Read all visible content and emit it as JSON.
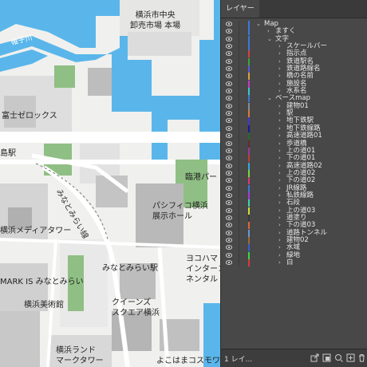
{
  "map": {
    "labels": [
      {
        "id": "market",
        "text": "横浜市中央\n卸売市場 本場"
      },
      {
        "id": "river",
        "text": "帷子川"
      },
      {
        "id": "fujixerox",
        "text": "富士ゼロックス"
      },
      {
        "id": "station_left",
        "text": "島駅"
      },
      {
        "id": "minatomirai_line",
        "text": "みなとみらい線"
      },
      {
        "id": "pier",
        "text": "臨港パー"
      },
      {
        "id": "pacifico",
        "text": "パシフィコ横浜\n展示ホール"
      },
      {
        "id": "media_tower",
        "text": "横浜メディアタワー"
      },
      {
        "id": "minatomirai_st",
        "text": "みなとみらい駅"
      },
      {
        "id": "yokohama_ic",
        "text": "ヨコハマ\nインターコ\nネンタル"
      },
      {
        "id": "markis",
        "text": "MARK IS みなとみらい"
      },
      {
        "id": "museum",
        "text": "横浜美術館"
      },
      {
        "id": "queens",
        "text": "クイーンズ\nスクエア横浜"
      },
      {
        "id": "landmark",
        "text": "横浜ランド\nマークタワー"
      },
      {
        "id": "cosmo",
        "text": "よこはまコスモワ"
      }
    ]
  },
  "panel": {
    "tab_label": "レイヤー",
    "footer_count": "1 レイ...",
    "layers": [
      {
        "name": "Map",
        "depth": 0,
        "expanded": true,
        "color": "#3a7bd5"
      },
      {
        "name": "ますく",
        "depth": 1,
        "expanded": false,
        "color": "#3a7bd5"
      },
      {
        "name": "文字",
        "depth": 1,
        "expanded": true,
        "color": "#3a7bd5"
      },
      {
        "name": "スケールバー",
        "depth": 2,
        "expanded": false,
        "color": "#3a7bd5"
      },
      {
        "name": "指示点",
        "depth": 2,
        "expanded": false,
        "color": "#d94040"
      },
      {
        "name": "鉄道駅名",
        "depth": 2,
        "expanded": false,
        "color": "#3aa83a"
      },
      {
        "name": "鉄道路線名",
        "depth": 2,
        "expanded": false,
        "color": "#5a5ad9"
      },
      {
        "name": "橋の名前",
        "depth": 2,
        "expanded": false,
        "color": "#d9a23a"
      },
      {
        "name": "施設名",
        "depth": 2,
        "expanded": false,
        "color": "#c83ac8"
      },
      {
        "name": "水系名",
        "depth": 2,
        "expanded": false,
        "color": "#3ac8c8"
      },
      {
        "name": "ベースmap",
        "depth": 1,
        "expanded": true,
        "color": "#3a7bd5"
      },
      {
        "name": "建物01",
        "depth": 2,
        "expanded": false,
        "color": "#8a8a8a"
      },
      {
        "name": "駅",
        "depth": 2,
        "expanded": false,
        "color": "#d97a3a"
      },
      {
        "name": "地下鉄駅",
        "depth": 2,
        "expanded": false,
        "color": "#3a3ad9"
      },
      {
        "name": "地下鉄線路",
        "depth": 2,
        "expanded": false,
        "color": "#1a1a9a"
      },
      {
        "name": "高速道路01",
        "depth": 2,
        "expanded": false,
        "color": "#2a6a2a"
      },
      {
        "name": "歩道橋",
        "depth": 2,
        "expanded": false,
        "color": "#6a2a2a"
      },
      {
        "name": "上の道01",
        "depth": 2,
        "expanded": false,
        "color": "#9a3a9a"
      },
      {
        "name": "下の道01",
        "depth": 2,
        "expanded": false,
        "color": "#c83a3a"
      },
      {
        "name": "高速道路02",
        "depth": 2,
        "expanded": false,
        "color": "#3aa8d9"
      },
      {
        "name": "上の道02",
        "depth": 2,
        "expanded": false,
        "color": "#7ad93a"
      },
      {
        "name": "下の道02",
        "depth": 2,
        "expanded": false,
        "color": "#d93a7a"
      },
      {
        "name": "JR線路",
        "depth": 2,
        "expanded": false,
        "color": "#3a7bd5"
      },
      {
        "name": "私鉄線路",
        "depth": 2,
        "expanded": false,
        "color": "#a83ad9"
      },
      {
        "name": "石段",
        "depth": 2,
        "expanded": false,
        "color": "#3ad9a8"
      },
      {
        "name": "上の道03",
        "depth": 2,
        "expanded": false,
        "color": "#d9d93a"
      },
      {
        "name": "道塗り",
        "depth": 2,
        "expanded": false,
        "color": "#3a3a3a"
      },
      {
        "name": "下の道03",
        "depth": 2,
        "expanded": false,
        "color": "#d96a3a"
      },
      {
        "name": "道路トンネル",
        "depth": 2,
        "expanded": false,
        "color": "#6a9ad9"
      },
      {
        "name": "建物02",
        "depth": 2,
        "expanded": false,
        "color": "#9a6a3a"
      },
      {
        "name": "水域",
        "depth": 2,
        "expanded": false,
        "color": "#3a5ad9"
      },
      {
        "name": "緑地",
        "depth": 2,
        "expanded": false,
        "color": "#3ad93a"
      },
      {
        "name": "白",
        "depth": 2,
        "expanded": false,
        "color": "#d93a3a"
      }
    ],
    "footer_icons": [
      "export-icon",
      "new-sublayer-icon",
      "locate-icon",
      "new-layer-icon",
      "trash-icon"
    ]
  }
}
